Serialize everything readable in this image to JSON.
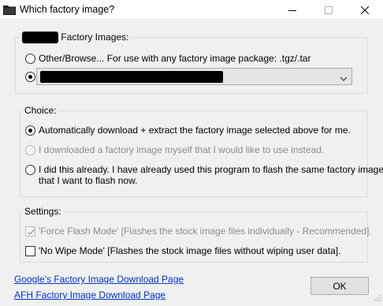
{
  "window": {
    "title": "Which factory image?",
    "controls": [
      "minimize",
      "maximize",
      "close"
    ]
  },
  "factory_images": {
    "legend": "Factory Images:",
    "option_browse_label": "Other/Browse...  For use with any factory image package: .tgz/.tar",
    "option_browse_checked": false,
    "option_list_checked": true,
    "dropdown_value": ""
  },
  "choice": {
    "legend": "Choice:",
    "options": [
      {
        "label": "Automatically download + extract the factory image selected above for me.",
        "checked": true,
        "enabled": true
      },
      {
        "label": "I downloaded a factory image myself that I would like to use instead.",
        "checked": false,
        "enabled": false
      },
      {
        "label": "I did this already. I have already used this program to flash the same factory image",
        "label_line2": "that I want to flash now.",
        "checked": false,
        "enabled": true
      }
    ]
  },
  "settings": {
    "legend": "Settings:",
    "force_flash_label": "'Force Flash Mode' [Flashes the stock image files individually - Recommended].",
    "force_flash_checked": true,
    "no_wipe_label": "'No Wipe Mode' [Flashes the stock image files without wiping user data].",
    "no_wipe_checked": false
  },
  "links": {
    "google": "Google's Factory Image Download Page",
    "afh": "AFH Factory Image Download Page"
  },
  "buttons": {
    "ok": "OK"
  }
}
